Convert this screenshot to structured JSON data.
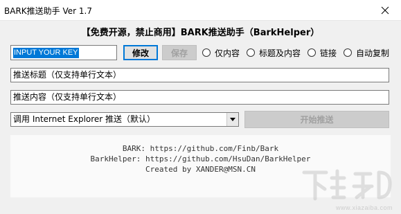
{
  "window": {
    "title": "BARK推送助手 Ver 1.7",
    "close_icon": "close-icon"
  },
  "header": {
    "heading": "【免费开源，禁止商用】BARK推送助手（BarkHelper）"
  },
  "key": {
    "value": "INPUT YOUR KEY"
  },
  "buttons": {
    "modify": "修改",
    "save": "保存",
    "send": "开始推送"
  },
  "radios": [
    {
      "label": "仅内容"
    },
    {
      "label": "标题及内容"
    },
    {
      "label": "链接"
    },
    {
      "label": "自动复制"
    }
  ],
  "fields": {
    "title_value": "推送标题（仅支持单行文本）",
    "content_value": "推送内容（仅支持单行文本）"
  },
  "browser_select": {
    "selected": "调用 Internet Explorer 推送（默认）"
  },
  "info": {
    "bark_line": "BARK: https://github.com/Finb/Bark",
    "helper_line": "BarkHelper: https://github.com/HsuDan/BarkHelper",
    "created_line": "Created by XANDER@MSN.CN"
  },
  "watermark": {
    "url": "www.xiazaiba.com"
  }
}
